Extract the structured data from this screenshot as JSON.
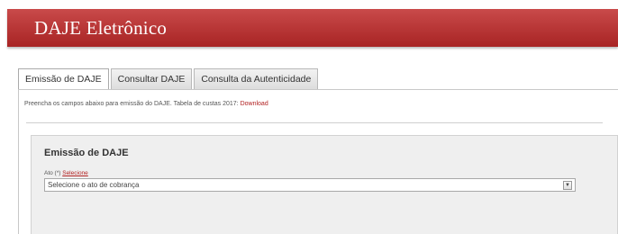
{
  "header": {
    "title": "DAJE Eletrônico"
  },
  "tabs": [
    {
      "label": "Emissão de DAJE",
      "active": true
    },
    {
      "label": "Consultar DAJE",
      "active": false
    },
    {
      "label": "Consulta da Autenticidade",
      "active": false
    }
  ],
  "notice": {
    "text": "Preencha os campos abaixo para emissão do DAJE. Tabela de custas 2017:",
    "link_label": "Download"
  },
  "panel": {
    "title": "Emissão de DAJE",
    "field_label": "Ato (*)",
    "help_link": "Selecione",
    "select_value": "Selecione o ato de cobrança",
    "arrow_glyph": "▼"
  },
  "colors": {
    "header_bg": "#b83232",
    "link": "#b22222",
    "panel_bg": "#efefef"
  }
}
